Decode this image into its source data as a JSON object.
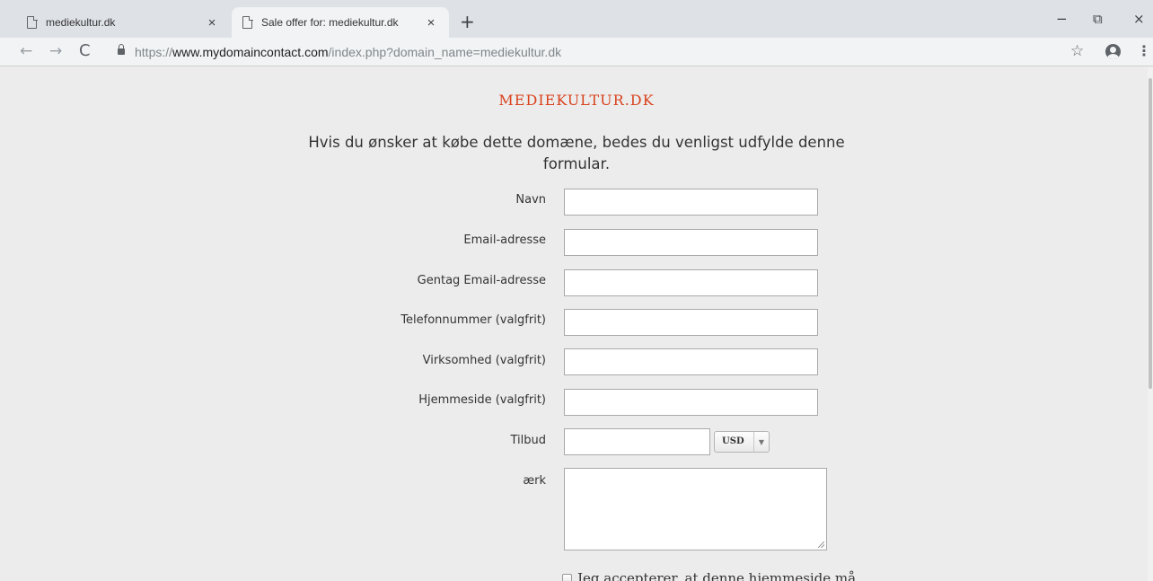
{
  "browser": {
    "tabs": [
      {
        "title": "mediekultur.dk",
        "close": "×"
      },
      {
        "title": "Sale offer for: mediekultur.dk",
        "close": "×"
      }
    ],
    "new_tab": "+",
    "window_controls": {
      "minimize": "−",
      "restore": "⧉",
      "close": "×"
    },
    "nav": {
      "back": "←",
      "forward": "→",
      "reload": "C"
    },
    "url_prefix": "https://",
    "url_host": "www.mydomaincontact.com",
    "url_path": "/index.php?domain_name=mediekultur.dk",
    "star": "☆",
    "menu": "⋮"
  },
  "page": {
    "site_title": "MEDIEKULTUR.DK",
    "intro": "Hvis du ønsker at købe dette domæne, bedes du venligst udfylde denne formular.",
    "form": {
      "name_label": "Navn",
      "email_label": "Email-adresse",
      "email_repeat_label": "Gentag Email-adresse",
      "phone_label": "Telefonnummer (valgfrit)",
      "company_label": "Virksomhed (valgfrit)",
      "website_label": "Hjemmeside (valgfrit)",
      "offer_label": "Tilbud",
      "currency": "USD",
      "currency_arrow": "▼",
      "message_label": "ærk",
      "consent_text": "Jeg accepterer, at denne hjemmeside må"
    }
  },
  "colors": {
    "accent": "#d9421d",
    "page_bg": "#ececec",
    "tabstrip_bg": "#dee1e6"
  }
}
